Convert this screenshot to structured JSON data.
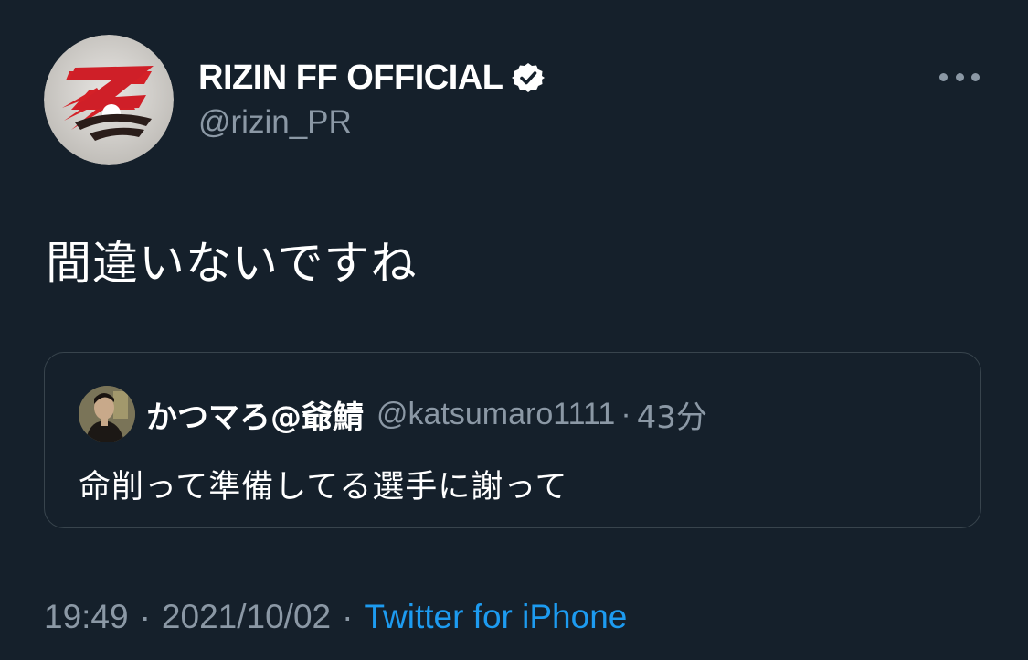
{
  "author": {
    "display_name": "RIZIN FF OFFICIAL",
    "handle": "@rizin_PR",
    "verified": true,
    "avatar_icon": "rizin-logo-avatar"
  },
  "more_icon": "more-horizontal-icon",
  "tweet": {
    "text": "間違いないですね"
  },
  "quoted_tweet": {
    "display_name": "かつマろ@爺鯖",
    "handle": "@katsumaro1111",
    "separator": "·",
    "time": "43分",
    "text": "命削って準備してる選手に謝って",
    "avatar_icon": "user-avatar"
  },
  "meta": {
    "time": "19:49",
    "date": "2021/10/02",
    "separator": "·",
    "source": "Twitter for iPhone"
  },
  "colors": {
    "background": "#15202b",
    "primary_text": "#ffffff",
    "secondary_text": "#8b98a5",
    "link": "#1d9bf0",
    "border": "#38444d",
    "verified_badge": "#ffffff",
    "logo_red": "#d42027"
  }
}
